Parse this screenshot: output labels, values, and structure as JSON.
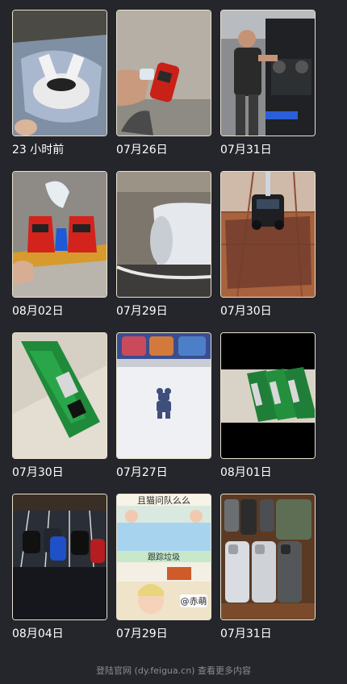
{
  "videos": [
    {
      "date": "23 小时前",
      "thumb": "white-supercar-doors-open-icon"
    },
    {
      "date": "07月26日",
      "thumb": "red-toy-car-on-hand-icon"
    },
    {
      "date": "07月31日",
      "thumb": "man-with-black-suv-icon"
    },
    {
      "date": "08月02日",
      "thumb": "three-red-toy-cars-icon"
    },
    {
      "date": "07月29日",
      "thumb": "car-door-interior-icon"
    },
    {
      "date": "07月30日",
      "thumb": "black-toy-suv-on-tiles-icon"
    },
    {
      "date": "07月30日",
      "thumb": "green-toy-bus-icon"
    },
    {
      "date": "07月27日",
      "thumb": "bearbrick-figure-icon"
    },
    {
      "date": "08月01日",
      "thumb": "green-toy-buses-row-icon"
    },
    {
      "date": "08月04日",
      "thumb": "toy-cars-parking-lot-icon"
    },
    {
      "date": "07月29日",
      "thumb": "anime-cartoon-collage-icon",
      "caption_top": "且猫问队么么",
      "caption_mid": "跟踪垃圾",
      "caption_badge": "@赤萌"
    },
    {
      "date": "07月31日",
      "thumb": "iphones-on-table-icon"
    }
  ],
  "footer": {
    "text": "登陆官网 (dy.feigua.cn) 查看更多内容"
  }
}
